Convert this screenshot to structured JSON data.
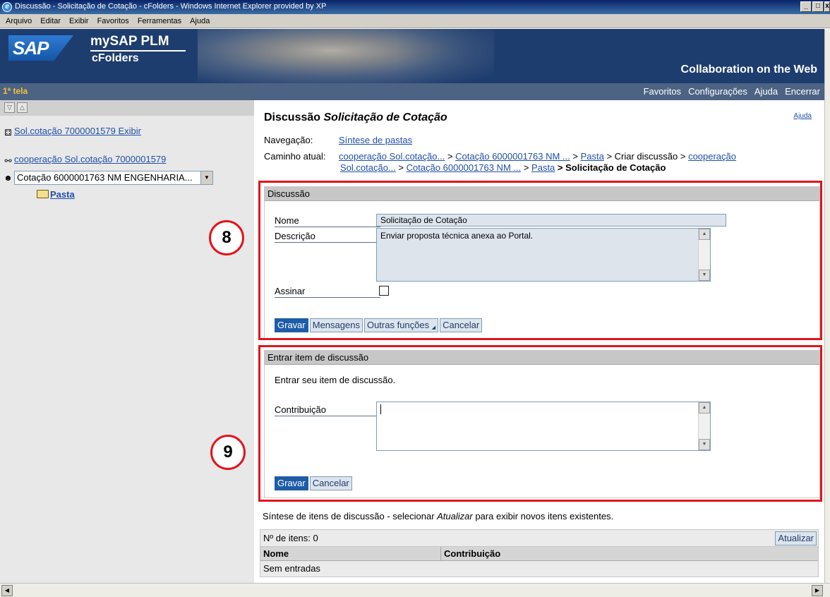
{
  "window": {
    "title": "Discussão - Solicitação de Cotação - cFolders - Windows Internet Explorer provided by XP"
  },
  "menu": [
    "Arquivo",
    "Editar",
    "Exibir",
    "Favoritos",
    "Ferramentas",
    "Ajuda"
  ],
  "banner": {
    "logo": "SAP",
    "product_line1": "mySAP PLM",
    "product_line2": "cFolders",
    "tagline": "Collaboration on the Web"
  },
  "navbar": {
    "screen_label": "1ª tela",
    "links": [
      "Favoritos",
      "Configurações",
      "Ajuda",
      "Encerrar"
    ]
  },
  "tree": {
    "root_link": "Sol.cotação 7000001579 Exibir",
    "cooperation_link": "cooperação Sol.cotação 7000001579",
    "quote_select": "Cotação 6000001763 NM ENGENHARIA...",
    "folder_link": "Pasta"
  },
  "page": {
    "title_prefix": "Discussão",
    "title_name": "Solicitação de Cotação",
    "help": "Ajuda",
    "nav_label": "Navegação:",
    "nav_link": "Síntese de pastas",
    "path_label": "Caminho atual:",
    "path_l1_a": "cooperação Sol.cotação...",
    "path_l1_sep1": " > ",
    "path_l1_b": "Cotação 6000001763 NM ...",
    "path_l1_sep2": " > ",
    "path_l1_c": "Pasta",
    "path_l1_text": " > Criar discussão > ",
    "path_l1_d": "cooperação",
    "path_l2_a": "Sol.cotação...",
    "path_l2_sep1": " > ",
    "path_l2_b": "Cotação 6000001763 NM ...",
    "path_l2_sep2": " > ",
    "path_l2_c": "Pasta",
    "path_l2_text": " > Solicitação de Cotação"
  },
  "discussion": {
    "header": "Discussão",
    "name_label": "Nome",
    "name_value": "Solicitação de Cotação",
    "desc_label": "Descrição",
    "desc_value": "Enviar proposta técnica anexa ao Portal.",
    "sign_label": "Assinar",
    "buttons": {
      "save": "Gravar",
      "messages": "Mensagens",
      "other": "Outras funções",
      "cancel": "Cancelar"
    }
  },
  "entry": {
    "header": "Entrar item de discussão",
    "instruction": "Entrar seu item de discussão.",
    "contrib_label": "Contribuição",
    "contrib_value": "",
    "buttons": {
      "save": "Gravar",
      "cancel": "Cancelar"
    }
  },
  "summary": {
    "text_pre": "Síntese de itens de discussão - selecionar ",
    "text_em": "Atualizar",
    "text_post": " para exibir novos itens existentes.",
    "count": "Nº de itens: 0",
    "refresh": "Atualizar",
    "columns": [
      "Nome",
      "Contribuição"
    ],
    "empty": "Sem entradas"
  },
  "callouts": [
    "8",
    "9"
  ],
  "colors": {
    "highlight": "#e2141b",
    "header_blue": "#1e3d6f",
    "nav_gray_blue": "#4d6384",
    "primary_button": "#1e5ca8"
  }
}
